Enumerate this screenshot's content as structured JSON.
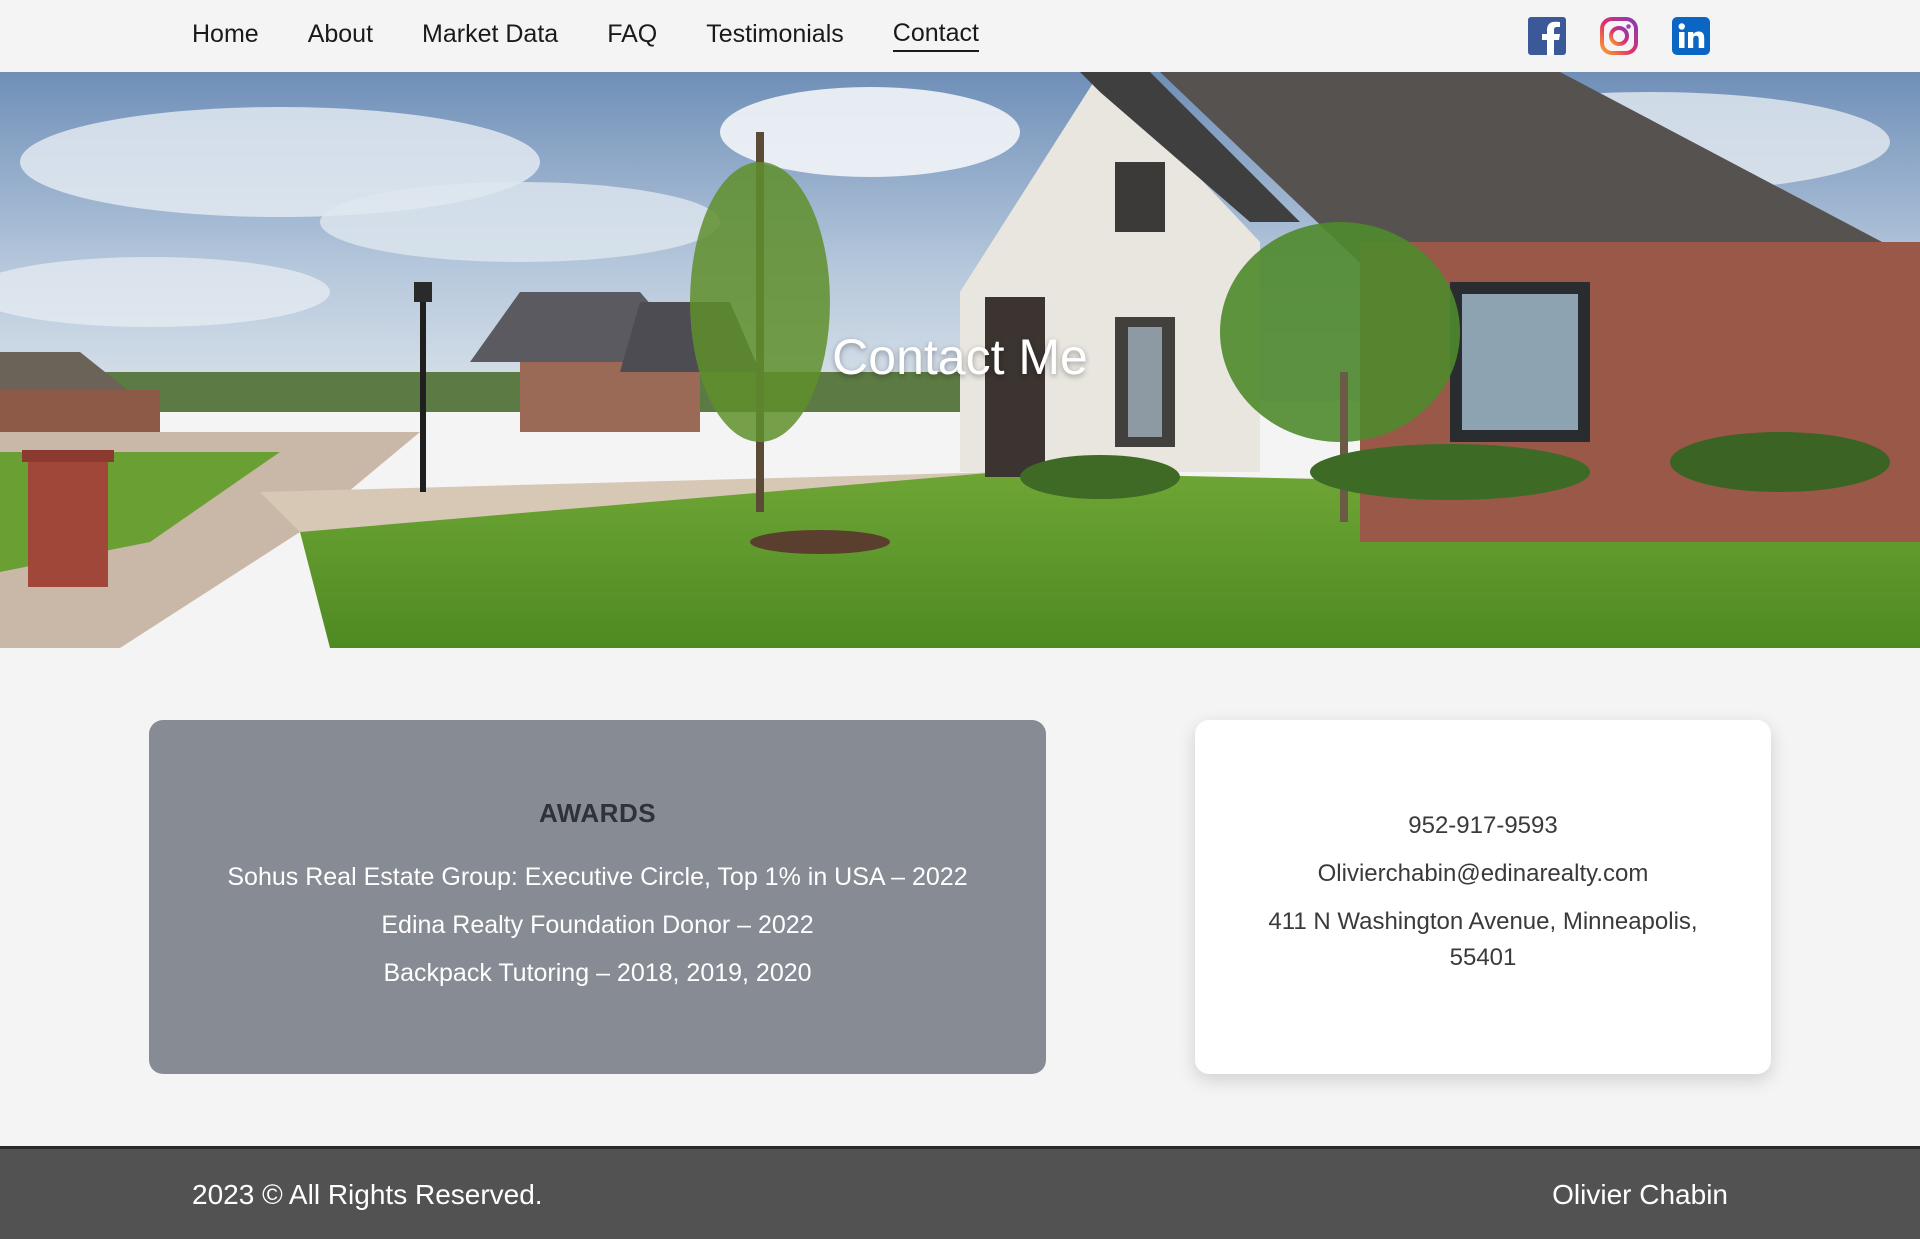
{
  "nav": {
    "items": [
      {
        "label": "Home"
      },
      {
        "label": "About"
      },
      {
        "label": "Market Data"
      },
      {
        "label": "FAQ"
      },
      {
        "label": "Testimonials"
      },
      {
        "label": "Contact"
      }
    ],
    "active": "Contact",
    "social": [
      "facebook-icon",
      "instagram-icon",
      "linkedin-icon"
    ]
  },
  "hero": {
    "title": "Contact Me"
  },
  "awards": {
    "title": "AWARDS",
    "items": [
      "Sohus Real Estate Group: Executive Circle, Top 1% in USA – 2022",
      "Edina Realty Foundation Donor – 2022",
      "Backpack Tutoring – 2018, 2019, 2020"
    ]
  },
  "contact": {
    "phone": "952-917-9593",
    "email": "Olivierchabin@edinarealty.com",
    "address": "411 N Washington Avenue, Minneapolis, 55401"
  },
  "footer": {
    "copyright": "2023 © All Rights Reserved.",
    "name": "Olivier Chabin"
  },
  "colors": {
    "awards_bg": "#868b94",
    "footer_bg": "#525252",
    "page_bg": "#f4f4f4"
  }
}
